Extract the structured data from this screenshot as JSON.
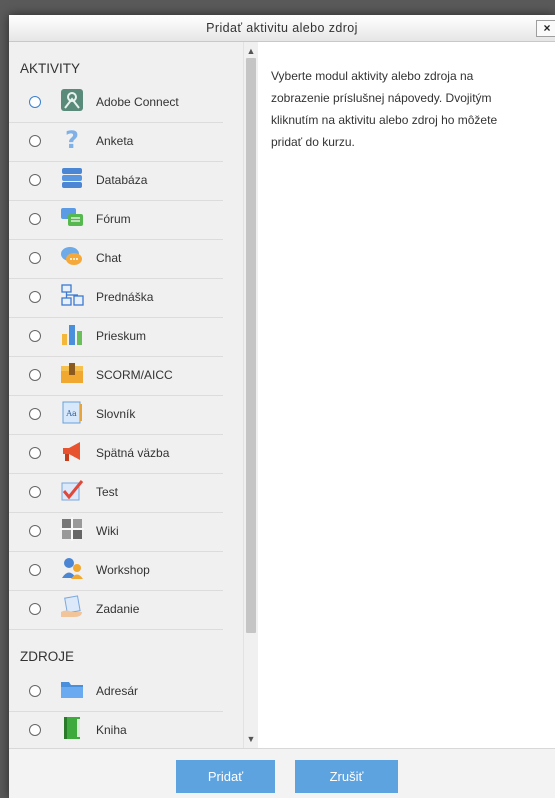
{
  "dialog": {
    "title": "Pridať aktivitu alebo zdroj",
    "close_label": "×"
  },
  "activities": {
    "heading": "AKTIVITY",
    "items": [
      {
        "label": "Adobe Connect",
        "icon": "adobe-connect-icon"
      },
      {
        "label": "Anketa",
        "icon": "question-mark-icon"
      },
      {
        "label": "Databáza",
        "icon": "database-icon"
      },
      {
        "label": "Fórum",
        "icon": "forum-icon"
      },
      {
        "label": "Chat",
        "icon": "chat-icon"
      },
      {
        "label": "Prednáška",
        "icon": "lesson-flowchart-icon"
      },
      {
        "label": "Prieskum",
        "icon": "bar-chart-icon"
      },
      {
        "label": "SCORM/AICC",
        "icon": "package-box-icon"
      },
      {
        "label": "Slovník",
        "icon": "glossary-book-icon"
      },
      {
        "label": "Spätná väzba",
        "icon": "megaphone-icon"
      },
      {
        "label": "Test",
        "icon": "checkmark-icon"
      },
      {
        "label": "Wiki",
        "icon": "wiki-puzzle-icon"
      },
      {
        "label": "Workshop",
        "icon": "workshop-people-icon"
      },
      {
        "label": "Zadanie",
        "icon": "assignment-hand-icon"
      }
    ]
  },
  "resources": {
    "heading": "ZDROJE",
    "items": [
      {
        "label": "Adresár",
        "icon": "folder-icon"
      },
      {
        "label": "Kniha",
        "icon": "book-icon"
      }
    ]
  },
  "help": {
    "text": "Vyberte modul aktivity alebo zdroja na zobrazenie príslušnej nápovedy. Dvojitým kliknutím na aktivitu alebo zdroj ho môžete pridať do kurzu."
  },
  "footer": {
    "add_label": "Pridať",
    "cancel_label": "Zrušiť"
  },
  "colors": {
    "button": "#5ca3e0",
    "pane": "#f0f0f0"
  }
}
